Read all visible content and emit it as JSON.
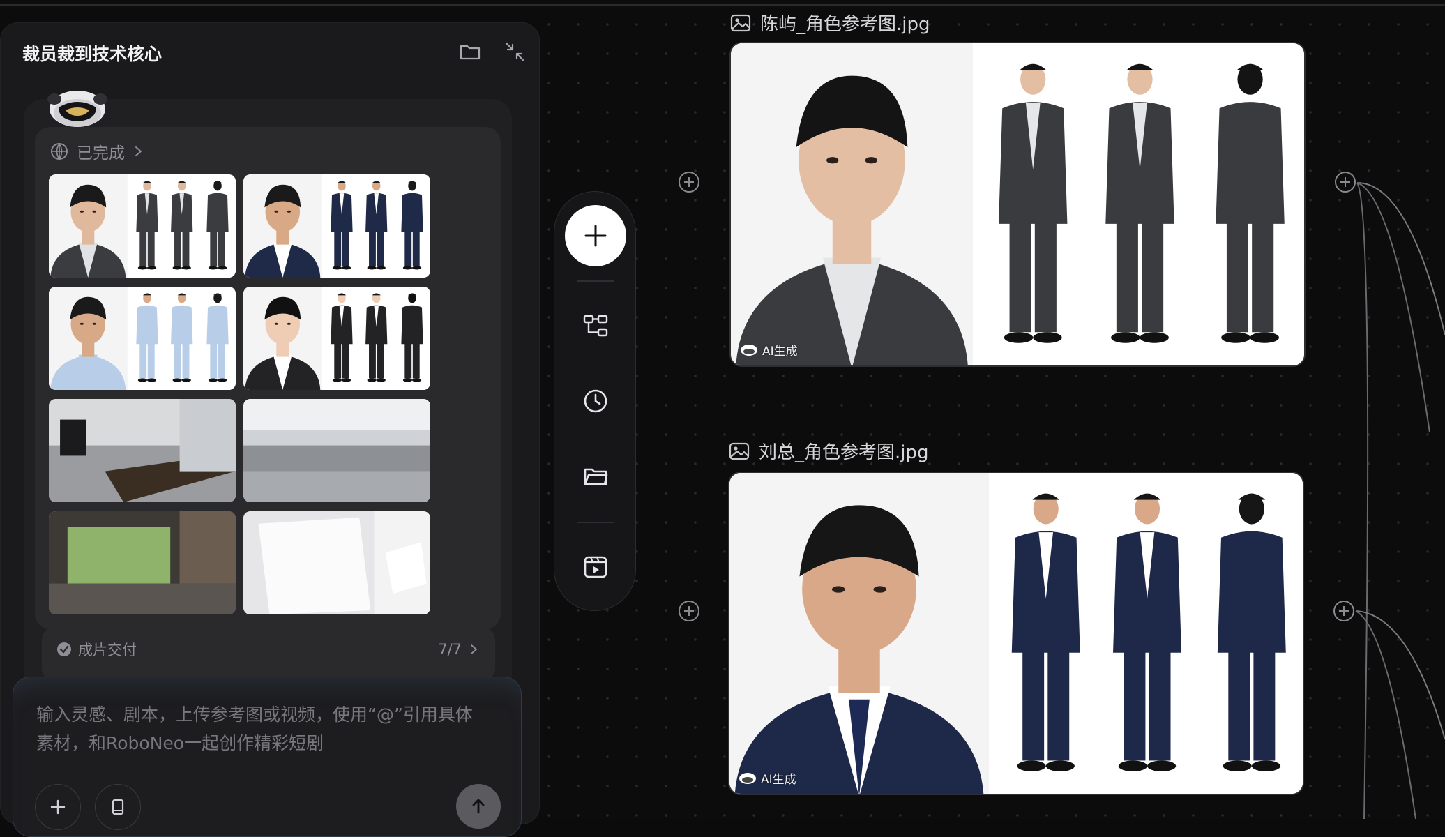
{
  "panel": {
    "title": "裁员裁到技术核心"
  },
  "task": {
    "status": "已完成"
  },
  "thumbnails": [
    {
      "kind": "person",
      "suit": "#3b3c40",
      "skin": "#e0b89c",
      "hair": "#1a1a1a",
      "shirt": "#dfe3e6"
    },
    {
      "kind": "person",
      "suit": "#1f2a48",
      "skin": "#d9a986",
      "hair": "#1a1a1a",
      "shirt": "#ffffff"
    },
    {
      "kind": "person",
      "suit": "#b7cde8",
      "skin": "#d8a987",
      "hair": "#1a1a1a",
      "shirt": "#b7cde8"
    },
    {
      "kind": "person",
      "suit": "#232326",
      "skin": "#efcdb5",
      "hair": "#111111",
      "shirt": "#ffffff"
    },
    {
      "kind": "room",
      "tone": "#6a6c70"
    },
    {
      "kind": "office",
      "tone": "#b9bdc2"
    },
    {
      "kind": "lobby",
      "tone": "#4b4640"
    },
    {
      "kind": "paper",
      "tone": "#e9e9ea"
    }
  ],
  "delivery": {
    "label": "成片交付",
    "count": "7/7"
  },
  "composer": {
    "placeholder_line1": "输入灵感、剧本，上传参考图或视频，使用“@”引用具体",
    "placeholder_line2": "素材，和RoboNeo一起创作精彩短剧"
  },
  "toolbar": {
    "items": [
      "add-icon",
      "workflow-icon",
      "history-icon",
      "folder-icon",
      "video-icon"
    ]
  },
  "nodes": [
    {
      "filename": "陈屿_角色参考图.jpg",
      "badge": "AI生成",
      "suit": "#3a3b3f",
      "shirt": "#e4e6e8",
      "skin": "#e3bea2",
      "hair": "#141414",
      "tie": ""
    },
    {
      "filename": "刘总_角色参考图.jpg",
      "badge": "AI生成",
      "suit": "#1e2949",
      "shirt": "#ffffff",
      "skin": "#d9a888",
      "hair": "#161616",
      "tie": "#1c2a55"
    }
  ],
  "colors": {
    "background": "#0c0c0d",
    "panel": "#1a1a1c",
    "accent_white": "#ffffff",
    "muted_text": "#8e8e94"
  }
}
